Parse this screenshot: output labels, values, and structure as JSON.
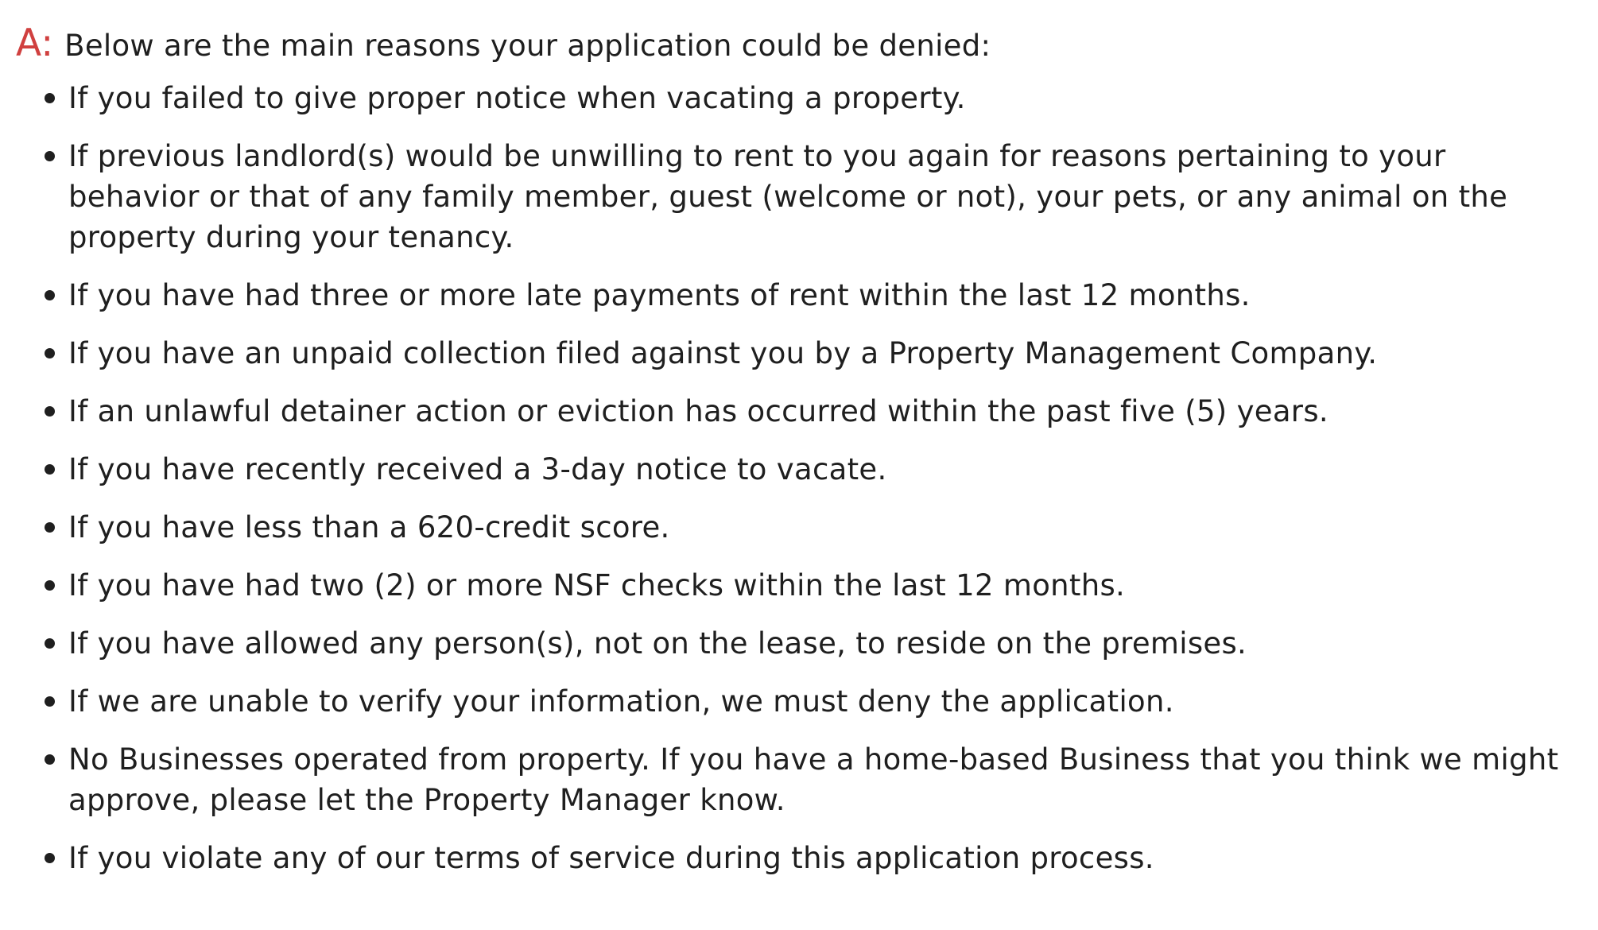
{
  "answer": {
    "marker": "A:",
    "marker_color": "#d0403f",
    "intro": "Below are the main reasons your application could be denied:",
    "reasons": [
      "If you failed to give proper notice when vacating a property.",
      "If previous landlord(s) would be unwilling to rent to you again for reasons pertaining to your behavior or that of any family member, guest (welcome or not), your pets, or any animal on the property during your tenancy.",
      "If you have had three or more late payments of rent within the last 12 months.",
      "If you have an unpaid collection filed against you by a Property Management Company.",
      "If an unlawful detainer action or eviction has occurred within the past five (5) years.",
      "If you have recently received a 3-day notice to vacate.",
      "If you have less than a 620-credit score.",
      "If you have had two (2) or more NSF checks within the last 12 months.",
      "If you have allowed any person(s), not on the lease, to reside on the premises.",
      "If we are unable to verify your information, we must deny the application.",
      "No Businesses operated from property. If you have a home-based Business that you think we might approve, please let the Property Manager know.",
      "If you violate any of our terms of service during this application process."
    ]
  }
}
